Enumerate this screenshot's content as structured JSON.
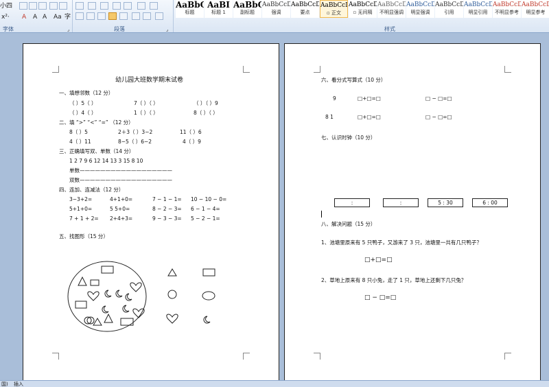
{
  "ribbon": {
    "groups": {
      "font": "字体",
      "paragraph": "段落",
      "styles": "样式"
    },
    "styles": [
      {
        "sample": "AaBbC",
        "name": "标题",
        "color": "#000000"
      },
      {
        "sample": "AaBI",
        "name": "标题 1",
        "color": "#000000"
      },
      {
        "sample": "AaBbC",
        "name": "副标题",
        "color": "#000000"
      },
      {
        "sample": "AaBbCcD",
        "name": "强调",
        "color": "#333333"
      },
      {
        "sample": "AaBbCcD",
        "name": "要点",
        "color": "#000000"
      },
      {
        "sample": "AaBbCcDc",
        "name": "▫ 正文",
        "color": "#000000",
        "active": true
      },
      {
        "sample": "AaBbCcDc",
        "name": "▫ 无间隔",
        "color": "#000000"
      },
      {
        "sample": "AaBbCcDc",
        "name": "不明显强调",
        "color": "#666666"
      },
      {
        "sample": "AaBbCcDc",
        "name": "明显强调",
        "color": "#2e5c9a"
      },
      {
        "sample": "AaBbCcDc",
        "name": "引用",
        "color": "#333333"
      },
      {
        "sample": "AaBbCcDc",
        "name": "明显引用",
        "color": "#2e5c9a"
      },
      {
        "sample": "AaBbCcD",
        "name": "不明显参考",
        "color": "#c0392b"
      },
      {
        "sample": "AaBbCcD",
        "name": "明显参考",
        "color": "#c0392b"
      }
    ]
  },
  "page1": {
    "title": "幼儿园大班数学期末试卷",
    "s1": "一、填想邻数（12 分）",
    "s1_rows": [
      [
        "（ ）5（ ）",
        "7（ ）（ ）",
        "（ ）（ ）9"
      ],
      [
        "（ ）4（ ）",
        "1（ ）（ ）",
        "8（ ）（ ）"
      ]
    ],
    "s2": "二、填 “>” “<” “=” （12 分）",
    "s2_rows": [
      [
        "8（ ）5",
        "2＋3（ ）3−2",
        "11（ ）6"
      ],
      [
        "4（ ）11",
        "8−5（ ）6−2",
        "4（ ）9"
      ]
    ],
    "s3": "三、正确填写双、单数（14 分）",
    "s3_numbers": "1  2  7  9  6  12  14  13  3  15  8  10",
    "s3_single": "单数——————————————————",
    "s3_double": "双数——————————————————",
    "s4": "四、连加、连减法（12 分）",
    "s4_rows": [
      [
        "3−3+2=",
        "4+1+0=",
        "7 − 1 − 1=",
        "10 − 10 − 0="
      ],
      [
        "5+1+0=",
        "5 5+0=",
        "8 − 2 − 3=",
        "6 − 1 − 4="
      ],
      [
        "7 + 1 + 2=",
        "2+4+3=",
        "9 − 3 − 3=",
        "5 − 2 − 1="
      ]
    ],
    "s5": "五、找图形（15 分）"
  },
  "page2": {
    "s6": "六、看分式写算式（10 分）",
    "s6_labels": [
      "9",
      "8   1"
    ],
    "s6_plus": "□+□=□",
    "s6_minus": "□ − □=□",
    "s7": "七、认识时钟（10 分）",
    "clocks": [
      ":",
      ":",
      "5 : 30",
      "6 : 00"
    ],
    "s8": "八、解决问题（15 分）",
    "q1": "1、池塘里原来有 5 只鸭子，又游来了 3 只，池塘里一共有几只鸭子？",
    "q1_eq": "□+□=□",
    "q2": "2、草地上原来有 8 只小兔，走了 1 只，草地上还剩下几只兔？",
    "q2_eq": "□ − □=□"
  },
  "status": {
    "left": "国)",
    "insert": "插入"
  }
}
